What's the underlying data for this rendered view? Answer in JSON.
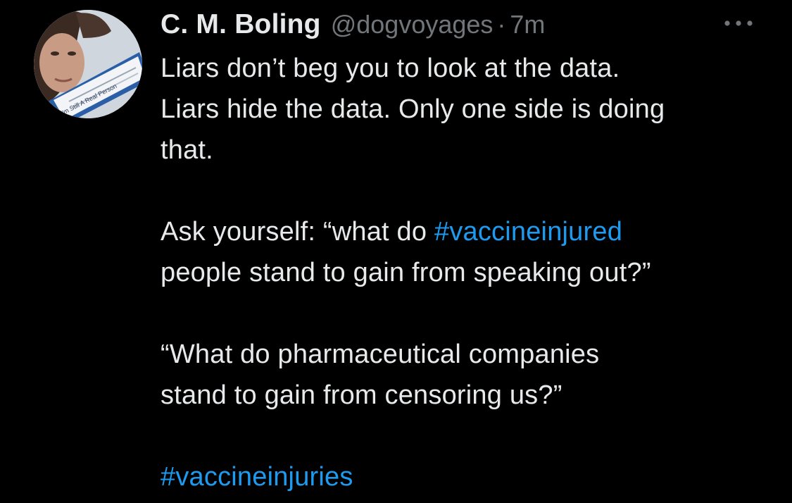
{
  "tweet": {
    "author": {
      "display_name": "C. M. Boling",
      "handle": "@dogvoyages",
      "separator": "·",
      "timestamp": "7m",
      "avatar_sign_text": "I'm Still A Real Person"
    },
    "more_icon": "more-horizontal-icon",
    "body": {
      "line1": "Liars don’t beg you to look at the data.",
      "line2": "Liars hide the data.  Only one side is doing",
      "line3": "that.",
      "line4_prefix": "Ask yourself: “what do ",
      "hashtag1": "#vaccineinjured",
      "line5": "people stand to gain from speaking out?”",
      "line6": "“What do pharmaceutical companies",
      "line7": "stand to gain from censoring us?”",
      "hashtag2": "#vaccineinjuries"
    }
  },
  "colors": {
    "background": "#000000",
    "text": "#e7e9ea",
    "secondary_text": "#71767b",
    "link": "#1d9bf0"
  }
}
